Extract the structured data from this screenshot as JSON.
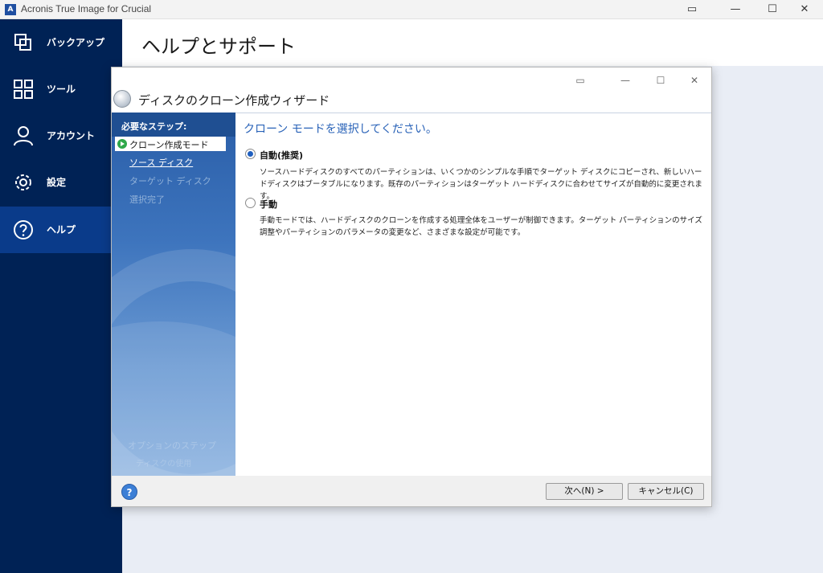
{
  "window": {
    "title": "Acronis True Image for Crucial",
    "logo_letter": "A",
    "controls": {
      "restore_icon": "▭",
      "minimize": "—",
      "maximize": "☐",
      "close": "✕"
    }
  },
  "sidebar": {
    "items": [
      {
        "label": "バックアップ",
        "icon": "backup-icon"
      },
      {
        "label": "ツール",
        "icon": "tools-icon"
      },
      {
        "label": "アカウント",
        "icon": "account-icon"
      },
      {
        "label": "設定",
        "icon": "gear-icon"
      },
      {
        "label": "ヘルプ",
        "icon": "help-icon",
        "active": true
      }
    ]
  },
  "header": {
    "title": "ヘルプとサポート"
  },
  "dialog": {
    "title": "ディスクのクローン作成ウィザード",
    "controls": {
      "restore_icon": "▭",
      "minimize": "—",
      "maximize": "☐",
      "close": "✕"
    },
    "steps": {
      "header": "必要なステップ:",
      "items": [
        {
          "label": "クローン作成モード",
          "state": "current"
        },
        {
          "label": "ソース ディスク",
          "state": "link"
        },
        {
          "label": "ターゲット ディスク",
          "state": "disabled"
        },
        {
          "label": "選択完了",
          "state": "disabled"
        }
      ],
      "optional_header": "オプションのステップ",
      "optional_item": "ディスクの使用"
    },
    "content": {
      "heading": "クローン モードを選択してください。",
      "options": [
        {
          "label": "自動(推奨)",
          "checked": true,
          "description": "ソースハードディスクのすべてのパーティションは、いくつかのシンプルな手順でターゲット ディスクにコピーされ、新しいハードディスクはブータブルになります。既存のパーティションはターゲット ハードディスクに合わせてサイズが自動的に変更されます。"
        },
        {
          "label": "手動",
          "checked": false,
          "description": "手動モードでは、ハードディスクのクローンを作成する処理全体をユーザーが制御できます。ターゲット パーティションのサイズ調整やパーティションのパラメータの変更など、さまざまな設定が可能です。"
        }
      ]
    },
    "footer": {
      "help_glyph": "?",
      "next_label": "次へ(N) >",
      "cancel_label": "キャンセル(C)"
    }
  },
  "colors": {
    "sidebar_bg": "#002255",
    "sidebar_active": "#0a3b8a",
    "heading_blue": "#2a63b8"
  }
}
